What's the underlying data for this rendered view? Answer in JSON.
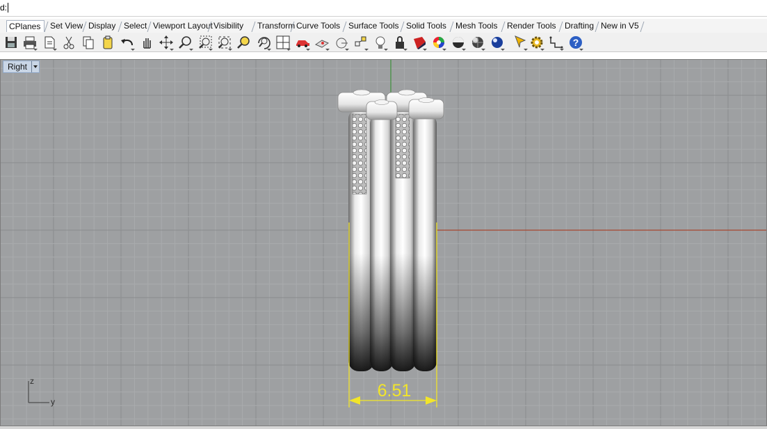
{
  "command": {
    "prompt": "d:"
  },
  "tabs": [
    {
      "label": "CPlanes"
    },
    {
      "label": "Set View"
    },
    {
      "label": "Display"
    },
    {
      "label": "Select"
    },
    {
      "label": "Viewport Layout"
    },
    {
      "label": "Visibility"
    },
    {
      "label": "Transform"
    },
    {
      "label": "Curve Tools"
    },
    {
      "label": "Surface Tools"
    },
    {
      "label": "Solid Tools"
    },
    {
      "label": "Mesh Tools"
    },
    {
      "label": "Render Tools"
    },
    {
      "label": "Drafting"
    },
    {
      "label": "New in V5"
    }
  ],
  "toolbar_icons": [
    "save-icon",
    "print-icon",
    "import-icon",
    "cut-icon",
    "copy-icon",
    "paste-icon",
    "undo-icon",
    "pan-icon",
    "rotate-view-icon",
    "zoom-icon",
    "zoom-window-icon",
    "zoom-extents-icon",
    "zoom-selected-icon",
    "rotate-camera-icon",
    "four-viewports-icon",
    "car-icon",
    "layer-cplane-icon",
    "circle-snap-icon",
    "object-snap-icon",
    "light-bulb-icon",
    "lock-icon",
    "material-icon",
    "color-wheel-icon",
    "shaded-sphere-icon",
    "render-sphere-icon",
    "glossy-sphere-icon",
    "pointer-icon",
    "settings-gear-icon",
    "dimension-tool-icon",
    "help-icon"
  ],
  "viewport": {
    "name": "Right",
    "axis_labels": {
      "vertical": "z",
      "horizontal": "y"
    },
    "dimension_value": "6.51",
    "colors": {
      "background": "#9ea0a2",
      "grid_minor": "#a9abad",
      "grid_major": "#8b8d8f",
      "x_axis": "#a8462f",
      "y_axis": "#3d8f3a",
      "dimension": "#f2e52a"
    }
  }
}
